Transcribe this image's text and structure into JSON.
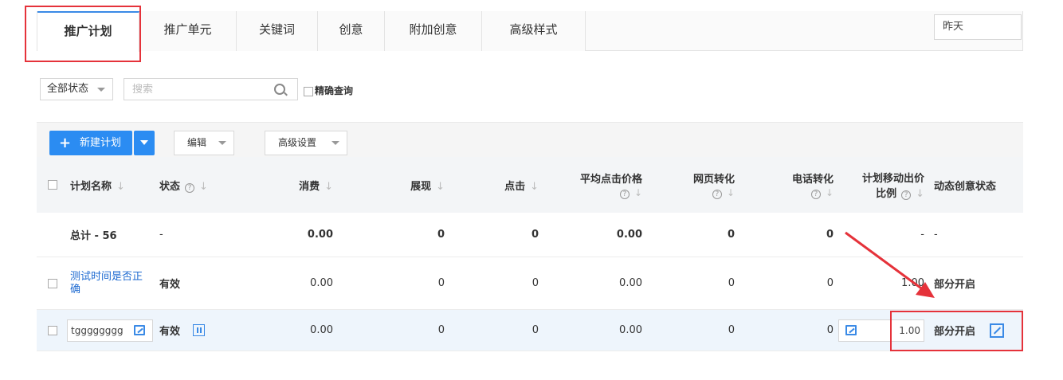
{
  "tabs": [
    {
      "label": "推广计划",
      "active": true
    },
    {
      "label": "推广单元"
    },
    {
      "label": "关键词"
    },
    {
      "label": "创意"
    },
    {
      "label": "附加创意"
    },
    {
      "label": "高级样式"
    }
  ],
  "date_range": "昨天",
  "filter": {
    "status": "全部状态",
    "search_placeholder": "搜索",
    "exact_label": "精确查询"
  },
  "toolbar": {
    "new_plan": "新建计划",
    "edit": "编辑",
    "advanced": "高级设置"
  },
  "columns": {
    "name": "计划名称",
    "status": "状态",
    "cost": "消费",
    "impressions": "展现",
    "clicks": "点击",
    "avg_cpc": "平均点击价格",
    "web_conv": "网页转化",
    "phone_conv": "电话转化",
    "mobile_ratio_1": "计划移动出价",
    "mobile_ratio_2": "比例",
    "dyn_creative": "动态创意状态"
  },
  "total_row": {
    "name": "总计 - 56",
    "status": "-",
    "cost": "0.00",
    "impressions": "0",
    "clicks": "0",
    "avg_cpc": "0.00",
    "web_conv": "0",
    "phone_conv": "0",
    "mobile_ratio": "-",
    "dyn_creative": "-"
  },
  "rows": [
    {
      "name": "测试时间是否正确",
      "status": "有效",
      "cost": "0.00",
      "impressions": "0",
      "clicks": "0",
      "avg_cpc": "0.00",
      "web_conv": "0",
      "phone_conv": "0",
      "mobile_ratio": "1.00",
      "dyn_creative": "部分开启"
    },
    {
      "name": "tgggggggg",
      "status": "有效",
      "cost": "0.00",
      "impressions": "0",
      "clicks": "0",
      "avg_cpc": "0.00",
      "web_conv": "0",
      "phone_conv": "0",
      "mobile_ratio": "1.00",
      "dyn_creative": "部分开启"
    }
  ],
  "colors": {
    "primary": "#2b8cf2",
    "highlight_red": "#e5323a",
    "link": "#1f6bd1"
  }
}
